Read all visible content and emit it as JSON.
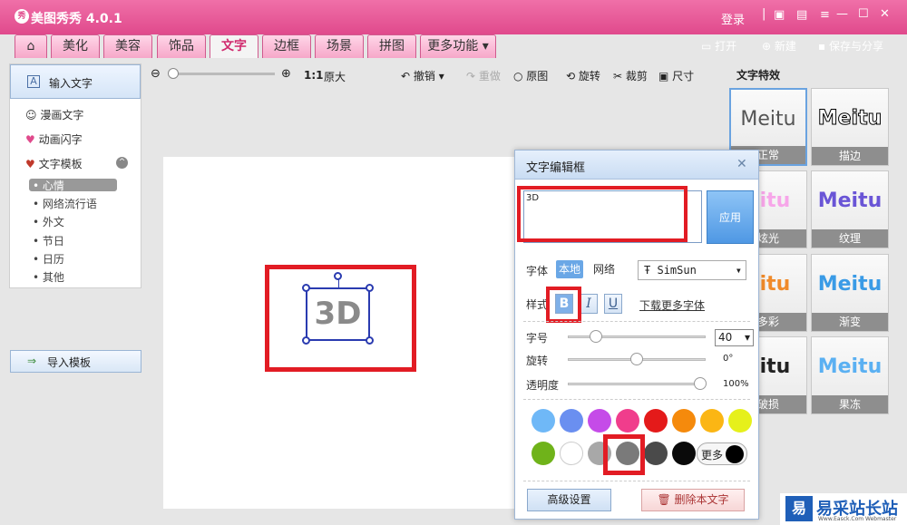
{
  "app": {
    "title": "美图秀秀 4.0.1",
    "logo": "秀"
  },
  "titlebar": {
    "login": "登录",
    "icons": [
      "chat-icon",
      "skin-icon",
      "menu-icon"
    ]
  },
  "tabs": [
    {
      "label": "⌂",
      "name": "home"
    },
    {
      "label": "美化"
    },
    {
      "label": "美容"
    },
    {
      "label": "饰品"
    },
    {
      "label": "文字",
      "active": true
    },
    {
      "label": "边框"
    },
    {
      "label": "场景"
    },
    {
      "label": "拼图"
    },
    {
      "label": "更多功能 ▾"
    }
  ],
  "right_tools": {
    "open": "打开",
    "new": "新建",
    "save": "保存与分享"
  },
  "left_panel": {
    "input_text": "输入文字",
    "items": [
      "漫画文字",
      "动画闪字",
      "文字模板"
    ],
    "sub_items": [
      "心情",
      "网络流行语",
      "外文",
      "节日",
      "日历",
      "其他"
    ],
    "import": "导入模板"
  },
  "toolbar": {
    "zoom_ratio": "1:1",
    "original_size": "原大",
    "undo": "撤销",
    "redo": "重做",
    "original": "原图",
    "rotate": "旋转",
    "crop": "裁剪",
    "size": "尺寸"
  },
  "canvas": {
    "text": "3D"
  },
  "effects": {
    "title": "文字特效",
    "items": [
      {
        "sample": "Meitu",
        "caption": "正常"
      },
      {
        "sample": "Meitu",
        "caption": "描边"
      },
      {
        "sample": "eitu",
        "caption": "炫光"
      },
      {
        "sample": "Meitu",
        "caption": "纹理"
      },
      {
        "sample": "eitu",
        "caption": "多彩"
      },
      {
        "sample": "Meitu",
        "caption": "渐变"
      },
      {
        "sample": "eitu",
        "caption": "破损"
      },
      {
        "sample": "Meitu",
        "caption": "果冻"
      }
    ]
  },
  "dialog": {
    "title": "文字编辑框",
    "text_value": "3D",
    "apply": "应用",
    "font_label": "字体",
    "font_local": "本地",
    "font_network": "网络",
    "font_name": "SimSun",
    "style_label": "样式",
    "bold": "B",
    "italic": "I",
    "underline": "U",
    "download_fonts": "下载更多字体",
    "size_label": "字号",
    "size_value": "40",
    "rotate_label": "旋转",
    "rotate_value": "0°",
    "opacity_label": "透明度",
    "opacity_value": "100%",
    "more": "更多",
    "advanced": "高级设置",
    "delete": "删除本文字"
  },
  "colors": [
    "#6fb8f7",
    "#6a8ff0",
    "#c54be8",
    "#f03d8c",
    "#e41a1a",
    "#f58a0c",
    "#fbb614",
    "#e6f01b",
    "#6fb31a",
    "#ffffff",
    "#a8a8a8",
    "#7a7a7a",
    "#4a4a4a",
    "#0a0a0a"
  ],
  "watermark": {
    "logo": "易",
    "text": "易采站长站",
    "sub": "Www.Easck.Com Webmaster"
  }
}
